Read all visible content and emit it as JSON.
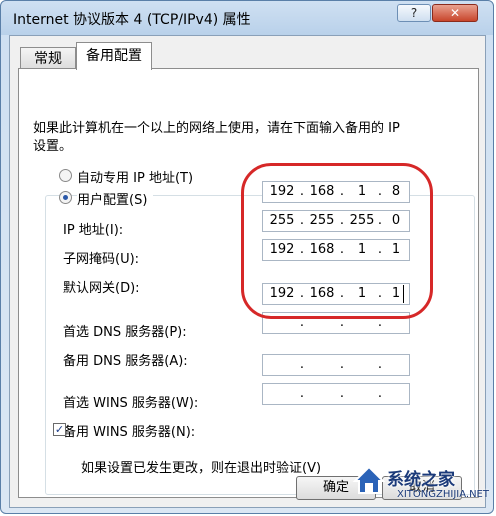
{
  "window": {
    "title": "Internet 协议版本 4 (TCP/IPv4) 属性",
    "help_btn": "?",
    "close_btn": "✕"
  },
  "tabs": [
    {
      "label": "常规",
      "active": false
    },
    {
      "label": "备用配置",
      "active": true
    }
  ],
  "description": {
    "line1": "如果此计算机在一个以上的网络上使用，请在下面输入备用的 IP",
    "line2": "设置。"
  },
  "radio_auto": {
    "label": "自动专用 IP 地址(T)",
    "selected": false
  },
  "radio_user": {
    "label": "用户配置(S)",
    "selected": true
  },
  "fields": [
    {
      "label": "IP 地址(I):",
      "value": [
        "192",
        "168",
        "1",
        "8"
      ]
    },
    {
      "label": "子网掩码(U):",
      "value": [
        "255",
        "255",
        "255",
        "0"
      ]
    },
    {
      "label": "默认网关(D):",
      "value": [
        "192",
        "168",
        "1",
        "1"
      ]
    },
    {
      "label": "首选 DNS 服务器(P):",
      "value": [
        "192",
        "168",
        "1",
        "1"
      ]
    },
    {
      "label": "备用 DNS 服务器(A):",
      "value": [
        "",
        "",
        "",
        ""
      ]
    },
    {
      "label": "首选 WINS 服务器(W):",
      "value": [
        "",
        "",
        "",
        ""
      ]
    },
    {
      "label": "备用 WINS 服务器(N):",
      "value": [
        "",
        "",
        "",
        ""
      ]
    }
  ],
  "checkbox": {
    "label": "如果设置已发生更改，则在退出时验证(V)",
    "checked": true,
    "mark": "✓"
  },
  "buttons": {
    "ok": "确定",
    "cancel": "取消"
  },
  "watermark": {
    "name": "系统之家",
    "url": "XITONGZHIJIA.NET"
  },
  "colors": {
    "highlight": "#d62828",
    "title_bar": "#b9d1ea"
  }
}
